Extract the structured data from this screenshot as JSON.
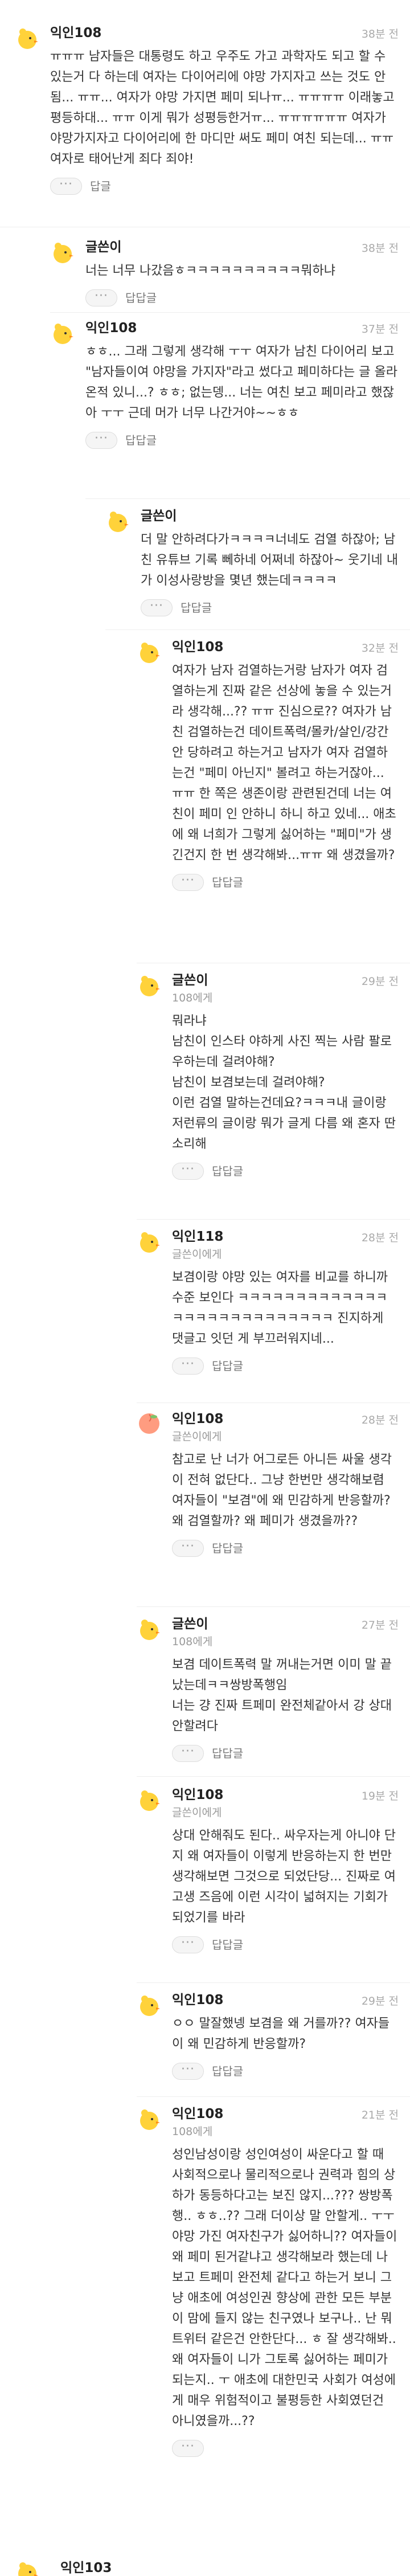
{
  "comments": [
    {
      "author": "익인108",
      "time": "38분 전",
      "text": "ㅠㅠㅠ 남자들은 대통령도 하고 우주도 가고 과학자도 되고 할 수 있는거 다 하는데 여자는 다이어리에 야망 가지자고 쓰는 것도 안됨... ㅠㅠ... 여자가 야망 가지면 페미 되나ㅠ... ㅠㅠㅠㅠ 이래놓고 평등하대... ㅠㅠ 이게 뭐가 성평등한거ㅠ... ㅠㅠㅠㅠㅠㅠ 여자가 야망가지자고 다이어리에 한 마디만 써도 페미 여친 되는데... ㅠㅠ 여자로 태어난게 죄다 죄야!",
      "more": "···",
      "reply": "답글"
    },
    {
      "author": "글쓴이",
      "time": "38분 전",
      "text": "너는 너무 나갔음ㅎㅋㅋㅋㅋㅋㅋㅋㅋㅋㅋ뭐하냐",
      "more": "···",
      "reply": "답답글"
    },
    {
      "author": "익인108",
      "time": "37분 전",
      "text": "ㅎㅎ... 그래 그렇게 생각해 ㅜㅜ 여자가 남친 다이어리 보고 \"남자들이여 야망을 가지자\"라고 썼다고 페미하다는 글 올라온적 있니...? ㅎㅎ; 없는뎅... 너는 여친 보고 페미라고 했잖아 ㅜㅜ 근데 머가 너무 나간거야~~ㅎㅎ",
      "more": "···",
      "reply": "답답글"
    },
    {
      "author": "글쓴이",
      "time": "",
      "text": "더 말 안하려다가ㅋㅋㅋㅋ너네도 검열 하잖아; 남친 유튜브 기록 뻬하네 어쩌네 하잖아~ 웃기네 내가 이성사랑방을 몇년 했는데ㅋㅋㅋㅋ",
      "more": "···",
      "reply": "답답글"
    },
    {
      "author": "익인108",
      "time": "32분 전",
      "text": "여자가 남자 검열하는거랑 남자가 여자 검열하는게 진짜 같은 선상에 놓을 수 있는거라 생각해...?? ㅠㅠ 진심으로?? 여자가 남친 검열하는건 데이트폭력/몰카/살인/강간 안 당하려고 하는거고 남자가 여자 검열하는건 \"페미 아닌지\" 볼려고 하는거잖아... ㅠㅠ 한 쪽은 생존이랑 관련된건데 너는 여친이 페미 인 안하니 하니 하고 있네... 애초에 왜 너희가 그렇게 싫어하는 \"페미\"가 생긴건지 한 번 생각해봐...ㅠㅠ 왜 생겼을까?",
      "more": "···",
      "reply": "답답글"
    },
    {
      "author": "글쓴이",
      "time": "29분 전",
      "mention": "108에게",
      "text": "뭐라냐\n남친이 인스타 야하게 사진 찍는 사람 팔로우하는데 걸려야해?\n남친이 보겸보는데 걸려야해?\n이런 검열 말하는건데요?ㅋㅋㅋ내 글이랑 저런류의 글이랑 뭐가 글게 다름 왜 혼자 딴소리해",
      "more": "···",
      "reply": "답답글"
    },
    {
      "author": "익인118",
      "time": "28분 전",
      "mention": "글쓴이에게",
      "text": "보겸이랑 야망 있는 여자를 비교를 하니까 수준 보인다 ㅋㅋㅋㅋㅋㅋㅋㅋㅋㅋㅋㅋㅋㅋㅋㅋㅋㅋㅋㅋㅋㅋㅋㅋㅋㅋㅋ 진지하게 댓글고 잇던 게 부끄러워지네...",
      "more": "···",
      "reply": "답답글"
    },
    {
      "author": "익인108",
      "time": "28분 전",
      "mention": "글쓴이에게",
      "text": "참고로 난 너가 어그로든 아니든 싸울 생각이 전혀 없단다.. 그냥 한번만 생각해보렴 여자들이 \"보겸\"에 왜 민감하게 반응할까? 왜 검열할까? 왜 페미가 생겼을까??",
      "more": "···",
      "reply": "답답글"
    },
    {
      "author": "글쓴이",
      "time": "27분 전",
      "mention": "108에게",
      "text": "보겸 데이트폭력 말 꺼내는거면 이미 말 끝났는데ㅋㅋ쌍방폭행임\n너는 걍 진짜 트페미 완전체같아서 강 상대 안할려다",
      "more": "···",
      "reply": "답답글"
    },
    {
      "author": "익인108",
      "time": "19분 전",
      "mention": "글쓴이에게",
      "text": "상대 안해줘도 된다.. 싸우자는게 아니야 단지 왜 여자들이 이렇게 반응하는지 한 번만 생각해보면 그것으로 되었단당... 진짜로 여고생 즈음에 이런 시각이 넓혀지는 기회가 되었기를 바라",
      "more": "···",
      "reply": "답답글"
    },
    {
      "author": "익인108",
      "time": "29분 전",
      "text": "ㅇㅇ 말잘했넹 보겸을 왜 거를까?? 여자들이 왜 민감하게 반응할까?",
      "more": "···",
      "reply": "답답글"
    },
    {
      "author": "익인108",
      "time": "21분 전",
      "mention": "108에게",
      "text": "성인남성이랑 성인여성이 싸운다고 할 때 사회적으로나 물리적으로나 권력과 힘의 상하가 동등하다고는 보진 않지...??? 쌍방폭행.. ㅎㅎ..?? 그래 더이상 말 안할게.. ㅜㅜ 야망 가진 여자친구가 싫어하니?? 여자들이 왜 페미 된거같냐고 생각해보라 했는데 나보고 트페미 완전체 같다고 하는거 보니 그냥 애초에 여성인권 향상에 관한 모든 부분이 맘에 들지 않는 친구였나 보구나.. 난 뭐 트위터 같은건 안한단다... ㅎ 잘 생각해봐.. 왜 여자들이 니가 그토록 싫어하는 페미가 되는지.. ㅜ 애초에 대한민국 사회가 여성에게 매우 위험적이고 불평등한 사회였던건 아니였을까...??",
      "more": "···",
      "reply": ""
    },
    {
      "author": "익인103",
      "time": "",
      "text": ""
    }
  ]
}
